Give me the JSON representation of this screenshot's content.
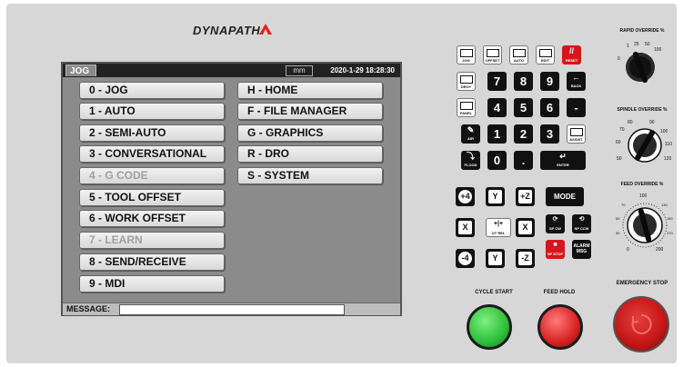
{
  "brand": {
    "name": "DYNAPATH",
    "accent": "#e3201b"
  },
  "screen": {
    "mode": "JOG",
    "unit": "mm",
    "datetime": "2020-1-29 18:28:30",
    "menu_left": [
      {
        "label": "0 - JOG",
        "enabled": true
      },
      {
        "label": "1 - AUTO",
        "enabled": true
      },
      {
        "label": "2 - SEMI-AUTO",
        "enabled": true
      },
      {
        "label": "3 - CONVERSATIONAL",
        "enabled": true
      },
      {
        "label": "4 - G CODE",
        "enabled": false
      },
      {
        "label": "5 - TOOL OFFSET",
        "enabled": true
      },
      {
        "label": "6 - WORK OFFSET",
        "enabled": true
      },
      {
        "label": "7 - LEARN",
        "enabled": false
      },
      {
        "label": "8 - SEND/RECEIVE",
        "enabled": true
      },
      {
        "label": "9 - MDI",
        "enabled": true
      }
    ],
    "menu_right": [
      {
        "label": "H - HOME",
        "enabled": true
      },
      {
        "label": "F - FILE MANAGER",
        "enabled": true
      },
      {
        "label": "G - GRAPHICS",
        "enabled": true
      },
      {
        "label": "R - DRO",
        "enabled": true
      },
      {
        "label": "S - SYSTEM",
        "enabled": true
      }
    ],
    "message_label": "MESSAGE:",
    "message_value": ""
  },
  "keypad": {
    "jog": "JOG",
    "offset": "OFFSET",
    "auto": "AUTO",
    "edit": "EDIT",
    "reset": "RESET",
    "dro": "DRO+",
    "panel": "PANEL",
    "air": "AIR",
    "flood": "FLOOD",
    "back": "BACK",
    "assist": "ASSIST",
    "enter": "ENTER",
    "digits": [
      "7",
      "8",
      "9",
      "4",
      "5",
      "6",
      "1",
      "2",
      "3",
      "0",
      "."
    ],
    "minus": "-"
  },
  "jog": {
    "plus4": "+4",
    "y_plus": "Y",
    "z_plus": "+Z",
    "x_minus": "X",
    "x_plus": "X",
    "minus4": "-4",
    "y_minus": "Y",
    "z_minus": "-Z",
    "mode": "MODE",
    "ot_rel": "OT REL",
    "sp_cw": "SP CW",
    "sp_ccw": "SP CCW",
    "sp_stop": "SP STOP",
    "alarm_msg": "ALARM MSG"
  },
  "knobs": {
    "rapid": {
      "title": "RAPID OVERRIDE %",
      "scale": [
        "0",
        "1",
        "25",
        "50",
        "100"
      ],
      "extra": [
        "x1",
        "x10",
        "x100"
      ]
    },
    "spindle": {
      "title": "SPINDLE OVERRIDE %",
      "scale": [
        "50",
        "60",
        "70",
        "80",
        "90",
        "100",
        "110",
        "120"
      ]
    },
    "feed": {
      "title": "FEED OVERRIDE %",
      "scale": [
        "0",
        "10",
        "20",
        "30",
        "40",
        "50",
        "60",
        "70",
        "80",
        "90",
        "100",
        "110",
        "120",
        "130",
        "140",
        "150",
        "160",
        "170",
        "180",
        "190",
        "200"
      ]
    }
  },
  "buttons": {
    "cycle_start": "CYCLE START",
    "feed_hold": "FEED HOLD",
    "emergency_stop": "EMERGENCY STOP"
  },
  "colors": {
    "screen_bg": "#8b8b8b",
    "cycle_start": "#2fbf3a",
    "feed_hold": "#d82222",
    "estop": "#c81818"
  }
}
